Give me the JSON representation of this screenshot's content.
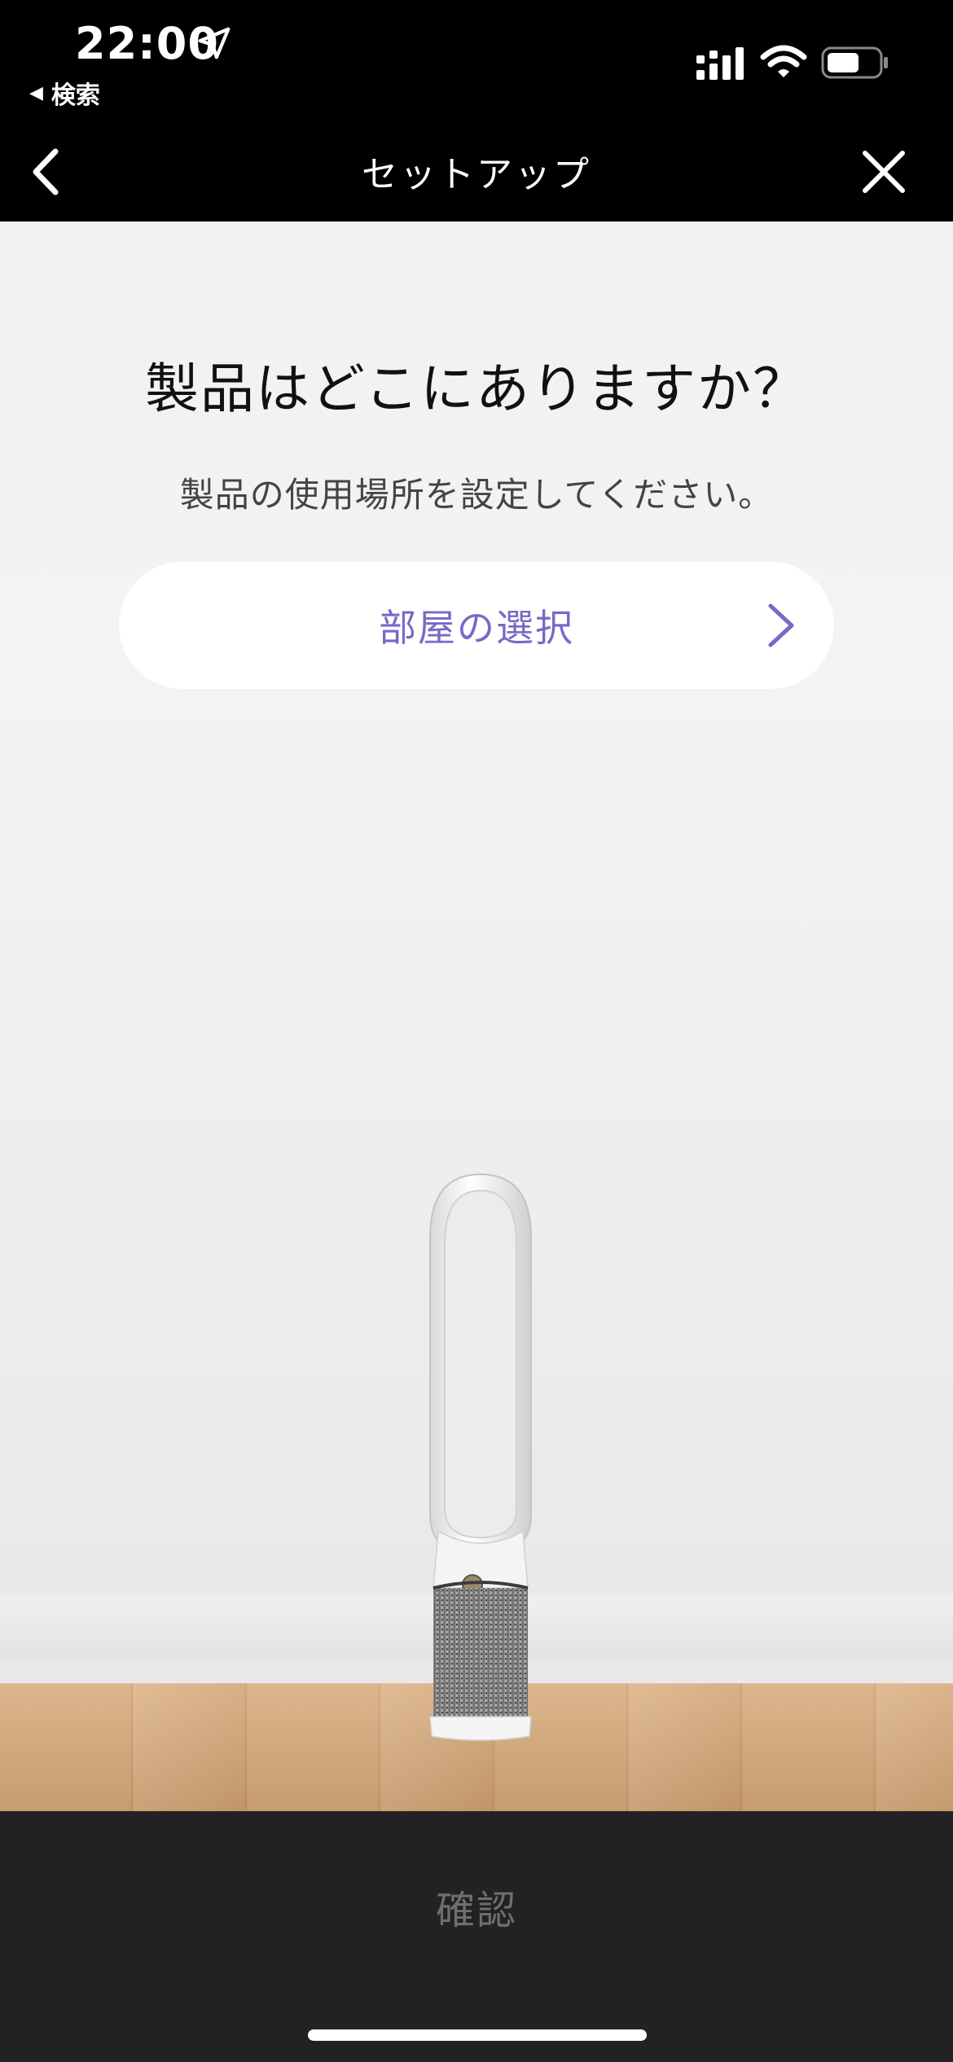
{
  "status_bar": {
    "time": "22:00",
    "back_app_label": "検索",
    "icons": [
      "location-arrow-icon",
      "cellular-signal-icon",
      "wifi-icon",
      "battery-icon"
    ]
  },
  "nav": {
    "title": "セットアップ",
    "back_icon": "chevron-left-icon",
    "close_icon": "close-icon"
  },
  "main": {
    "heading": "製品はどこにありますか？",
    "subheading": "製品の使用場所を設定してください。",
    "room_button_label": "部屋の選択",
    "room_button_icon": "chevron-right-icon",
    "accent_color": "#7b67c8"
  },
  "footer": {
    "confirm_label": "確認",
    "confirm_color": "#6f6f6f"
  }
}
